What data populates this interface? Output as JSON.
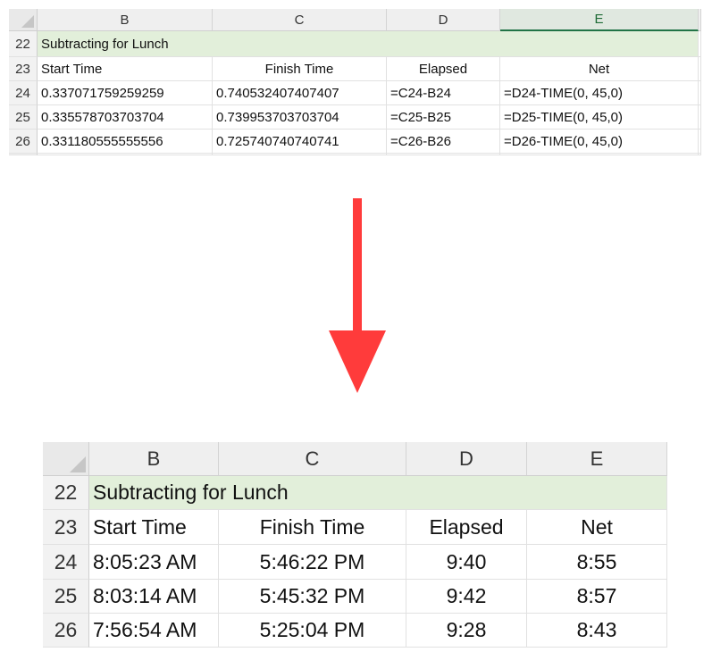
{
  "columns": [
    "B",
    "C",
    "D",
    "E"
  ],
  "selected_column": "E",
  "title_row": {
    "row": "22",
    "text": "Subtracting for Lunch"
  },
  "header_row": {
    "row": "23",
    "cells": [
      "Start Time",
      "Finish Time",
      "Elapsed",
      "Net"
    ]
  },
  "formula_view": {
    "rows": [
      {
        "row": "24",
        "cells": [
          "0.337071759259259",
          "0.740532407407407",
          "=C24-B24",
          "=D24-TIME(0, 45,0)"
        ]
      },
      {
        "row": "25",
        "cells": [
          "0.335578703703704",
          "0.739953703703704",
          "=C25-B25",
          "=D25-TIME(0, 45,0)"
        ]
      },
      {
        "row": "26",
        "cells": [
          "0.331180555555556",
          "0.725740740740741",
          "=C26-B26",
          "=D26-TIME(0, 45,0)"
        ]
      }
    ]
  },
  "result_view": {
    "rows": [
      {
        "row": "24",
        "cells": [
          "8:05:23 AM",
          "5:46:22 PM",
          "9:40",
          "8:55"
        ]
      },
      {
        "row": "25",
        "cells": [
          "8:03:14 AM",
          "5:45:32 PM",
          "9:42",
          "8:57"
        ]
      },
      {
        "row": "26",
        "cells": [
          "7:56:54 AM",
          "5:25:04 PM",
          "9:28",
          "8:43"
        ]
      }
    ]
  },
  "arrow": {
    "icon": "arrow-down-icon",
    "color": "#ff3b3b"
  },
  "colors": {
    "title_fill": "#e2efda",
    "selected_header": "#217346"
  }
}
